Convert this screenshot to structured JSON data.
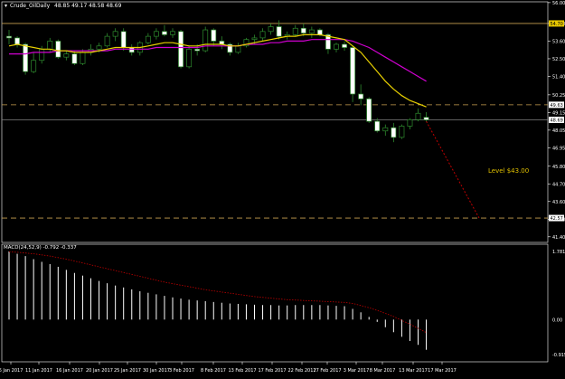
{
  "chart_data": {
    "type": "candlestick",
    "title": "Crude_OilDaily",
    "ohlc_header": "48.85 49.17 48.58 48.69",
    "y_ticks": [
      "56.00",
      "54.70",
      "53.60",
      "52.50",
      "51.40",
      "50.25",
      "49.15",
      "48.05",
      "46.95",
      "45.80",
      "44.70",
      "43.60",
      "42.50",
      "41.40"
    ],
    "ylim": [
      41.05,
      56.05
    ],
    "price_tags": [
      {
        "label": "54.70",
        "value": 54.7,
        "style": "yellow"
      },
      {
        "label": "49.63",
        "value": 49.63,
        "style": "white"
      },
      {
        "label": "48.69",
        "value": 48.69,
        "style": "white"
      },
      {
        "label": "42.57",
        "value": 42.57,
        "style": "white"
      }
    ],
    "h_lines": [
      {
        "value": 54.7,
        "color": "#c8a050",
        "dash": false
      },
      {
        "value": 49.63,
        "color": "#c8a050",
        "dash": true
      },
      {
        "value": 48.69,
        "color": "#808080",
        "dash": false
      },
      {
        "value": 42.57,
        "color": "#c8a050",
        "dash": true
      }
    ],
    "annotation": "Level $43.00",
    "projection": {
      "from": 48.6,
      "to": 42.57,
      "color": "#c00000"
    },
    "x_ticks": [
      "6 Jan 2017",
      "11 Jan 2017",
      "16 Jan 2017",
      "20 Jan 2017",
      "25 Jan 2017",
      "30 Jan 2017",
      "3 Feb 2017",
      "8 Feb 2017",
      "13 Feb 2017",
      "17 Feb 2017",
      "22 Feb 2017",
      "27 Feb 2017",
      "3 Mar 2017",
      "8 Mar 2017",
      "13 Mar 2017",
      "17 Mar 2017"
    ],
    "candles": [
      [
        53.9,
        54.3,
        53.4,
        53.8
      ],
      [
        53.8,
        53.9,
        53.2,
        53.4
      ],
      [
        53.4,
        53.5,
        51.5,
        51.7
      ],
      [
        51.7,
        52.9,
        51.6,
        52.4
      ],
      [
        52.4,
        53.3,
        52.2,
        53.1
      ],
      [
        53.1,
        53.8,
        52.9,
        53.6
      ],
      [
        53.6,
        53.7,
        52.5,
        52.6
      ],
      [
        52.6,
        53.0,
        52.4,
        52.8
      ],
      [
        52.8,
        53.0,
        52.1,
        52.2
      ],
      [
        52.2,
        53.1,
        52.1,
        52.9
      ],
      [
        52.9,
        53.4,
        52.7,
        53.1
      ],
      [
        53.1,
        53.5,
        52.9,
        53.3
      ],
      [
        53.3,
        54.1,
        53.2,
        53.9
      ],
      [
        53.9,
        54.4,
        53.6,
        54.2
      ],
      [
        54.2,
        54.4,
        53.0,
        53.2
      ],
      [
        53.2,
        53.4,
        52.7,
        52.9
      ],
      [
        52.9,
        53.6,
        52.7,
        53.5
      ],
      [
        53.5,
        54.1,
        53.4,
        53.9
      ],
      [
        53.9,
        54.4,
        53.7,
        54.2
      ],
      [
        54.2,
        54.6,
        53.9,
        54.0
      ],
      [
        54.0,
        54.4,
        53.8,
        54.2
      ],
      [
        54.2,
        54.3,
        51.9,
        52.0
      ],
      [
        52.0,
        53.3,
        51.9,
        53.1
      ],
      [
        53.1,
        53.4,
        52.7,
        53.0
      ],
      [
        53.0,
        54.5,
        52.9,
        54.3
      ],
      [
        54.3,
        54.4,
        53.3,
        53.6
      ],
      [
        53.6,
        53.9,
        53.1,
        53.4
      ],
      [
        53.4,
        53.5,
        52.7,
        52.9
      ],
      [
        52.9,
        53.5,
        52.8,
        53.3
      ],
      [
        53.3,
        53.8,
        53.2,
        53.7
      ],
      [
        53.7,
        54.0,
        53.4,
        53.8
      ],
      [
        53.8,
        54.4,
        53.6,
        54.2
      ],
      [
        54.2,
        54.7,
        54.0,
        54.5
      ],
      [
        54.5,
        54.9,
        53.7,
        53.9
      ],
      [
        53.9,
        54.2,
        53.7,
        54.0
      ],
      [
        54.0,
        54.6,
        53.9,
        54.4
      ],
      [
        54.4,
        54.7,
        53.9,
        54.1
      ],
      [
        54.1,
        54.5,
        53.8,
        54.3
      ],
      [
        54.3,
        54.4,
        53.9,
        54.0
      ],
      [
        54.0,
        54.1,
        52.8,
        53.1
      ],
      [
        53.1,
        53.5,
        52.9,
        53.4
      ],
      [
        53.4,
        53.6,
        53.0,
        53.2
      ],
      [
        53.2,
        53.3,
        49.8,
        50.3
      ],
      [
        50.3,
        50.9,
        49.6,
        50.0
      ],
      [
        50.0,
        50.1,
        48.5,
        48.6
      ],
      [
        48.6,
        48.8,
        47.9,
        48.0
      ],
      [
        48.0,
        48.4,
        47.7,
        48.2
      ],
      [
        48.2,
        48.5,
        47.3,
        47.6
      ],
      [
        47.6,
        48.4,
        47.5,
        48.3
      ],
      [
        48.3,
        48.8,
        48.1,
        48.7
      ],
      [
        48.7,
        49.4,
        48.6,
        49.1
      ],
      [
        48.85,
        49.17,
        48.58,
        48.69
      ]
    ],
    "ma_fast": [
      53.3,
      53.4,
      53.3,
      53.2,
      53.1,
      53.1,
      53.0,
      53.0,
      52.9,
      52.9,
      52.9,
      53.0,
      53.1,
      53.2,
      53.2,
      53.2,
      53.2,
      53.3,
      53.4,
      53.5,
      53.5,
      53.4,
      53.3,
      53.3,
      53.4,
      53.4,
      53.4,
      53.3,
      53.3,
      53.4,
      53.5,
      53.6,
      53.7,
      53.8,
      53.9,
      53.9,
      54.0,
      54.0,
      54.0,
      53.9,
      53.8,
      53.7,
      53.3,
      52.9,
      52.3,
      51.7,
      51.1,
      50.6,
      50.2,
      49.9,
      49.7,
      49.5
    ],
    "ma_slow": [
      52.8,
      52.8,
      52.8,
      52.9,
      52.9,
      52.9,
      53.0,
      53.0,
      53.0,
      53.0,
      53.0,
      53.0,
      53.0,
      53.1,
      53.1,
      53.1,
      53.1,
      53.1,
      53.2,
      53.2,
      53.2,
      53.2,
      53.2,
      53.2,
      53.3,
      53.3,
      53.3,
      53.3,
      53.3,
      53.4,
      53.4,
      53.4,
      53.5,
      53.5,
      53.6,
      53.6,
      53.6,
      53.7,
      53.7,
      53.7,
      53.7,
      53.7,
      53.6,
      53.4,
      53.2,
      52.9,
      52.6,
      52.3,
      52.0,
      51.7,
      51.4,
      51.1
    ],
    "macd": {
      "label": "MACD(24,52,9) -0.792 -0.337",
      "y_ticks": [
        "1.781",
        "0.00",
        "-0.915"
      ],
      "ylim": [
        -0.915,
        1.781
      ],
      "histogram": [
        1.78,
        1.72,
        1.66,
        1.58,
        1.51,
        1.45,
        1.38,
        1.3,
        1.22,
        1.15,
        1.08,
        1.01,
        0.95,
        0.89,
        0.84,
        0.79,
        0.74,
        0.7,
        0.66,
        0.62,
        0.58,
        0.55,
        0.52,
        0.5,
        0.48,
        0.46,
        0.44,
        0.42,
        0.41,
        0.4,
        0.39,
        0.38,
        0.38,
        0.37,
        0.37,
        0.38,
        0.38,
        0.38,
        0.38,
        0.37,
        0.36,
        0.35,
        0.28,
        0.19,
        0.07,
        -0.06,
        -0.2,
        -0.33,
        -0.45,
        -0.56,
        -0.66,
        -0.79
      ],
      "signal": [
        1.77,
        1.76,
        1.74,
        1.72,
        1.69,
        1.66,
        1.62,
        1.58,
        1.53,
        1.48,
        1.43,
        1.38,
        1.33,
        1.28,
        1.23,
        1.18,
        1.13,
        1.08,
        1.03,
        0.98,
        0.94,
        0.9,
        0.86,
        0.82,
        0.78,
        0.75,
        0.72,
        0.69,
        0.66,
        0.63,
        0.6,
        0.58,
        0.56,
        0.54,
        0.52,
        0.51,
        0.5,
        0.49,
        0.48,
        0.47,
        0.46,
        0.45,
        0.42,
        0.37,
        0.31,
        0.24,
        0.16,
        0.08,
        -0.02,
        -0.12,
        -0.23,
        -0.34
      ]
    }
  }
}
